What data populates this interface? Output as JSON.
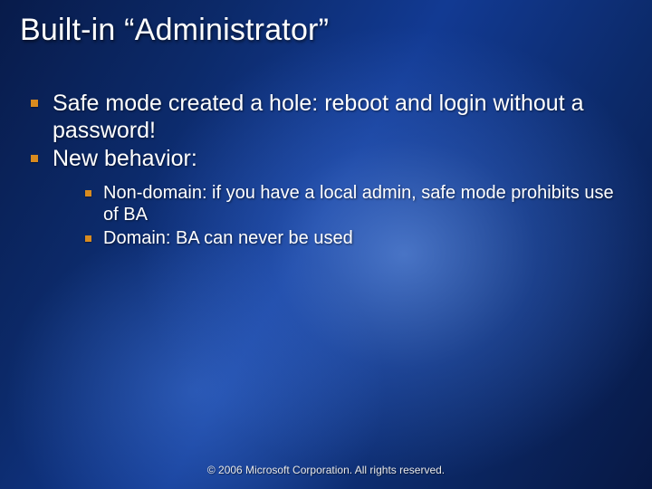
{
  "title": "Built-in “Administrator”",
  "bullets": {
    "level1": [
      "Safe mode created a hole: reboot and login without a password!",
      "New behavior:"
    ],
    "level2": [
      "Non-domain: if you have a local admin, safe mode prohibits use of BA",
      "Domain: BA can never be used"
    ]
  },
  "footer": "© 2006 Microsoft Corporation. All rights reserved."
}
